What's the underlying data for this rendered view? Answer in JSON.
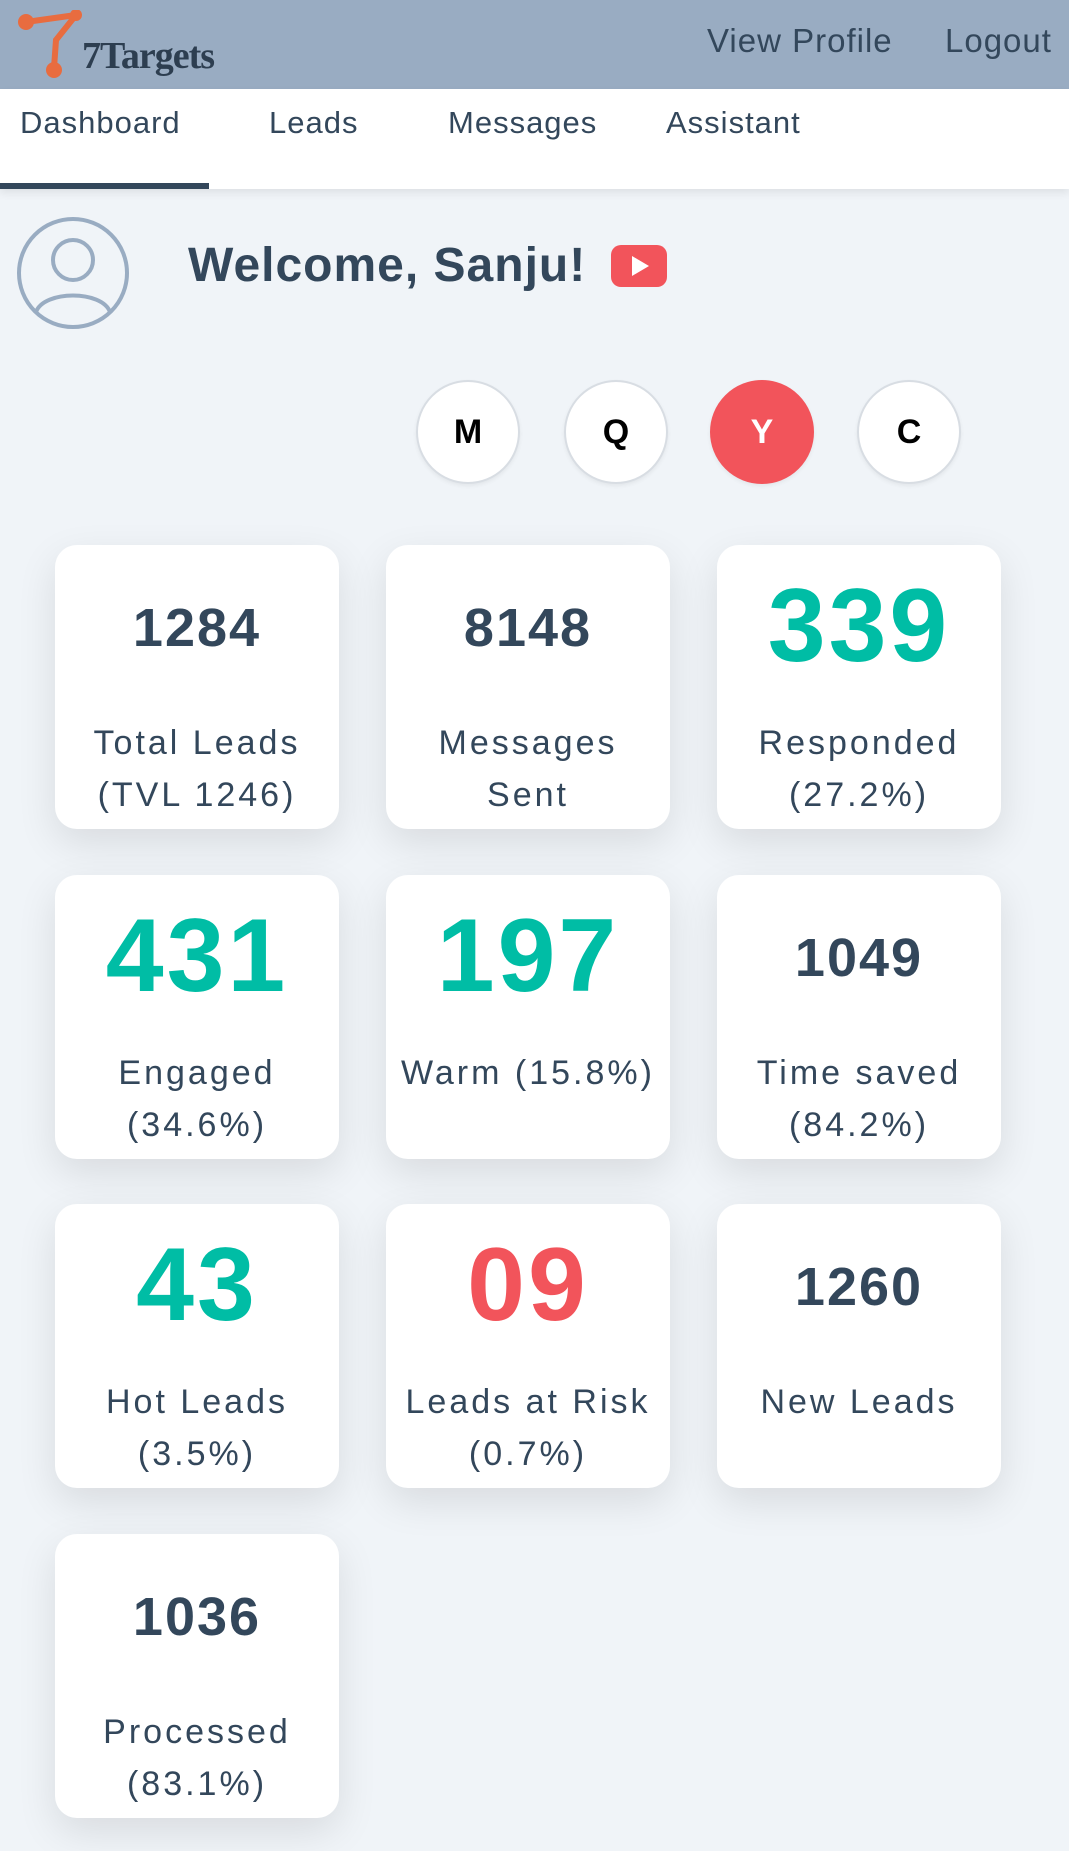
{
  "header": {
    "logo_text": "7Targets",
    "view_profile": "View Profile",
    "logout": "Logout"
  },
  "tabs": [
    {
      "label": "Dashboard",
      "active": true
    },
    {
      "label": "Leads"
    },
    {
      "label": "Messages"
    },
    {
      "label": "Assistant"
    }
  ],
  "welcome": {
    "text": "Welcome, Sanju!",
    "icon": "youtube-icon"
  },
  "periods": [
    {
      "label": "M"
    },
    {
      "label": "Q"
    },
    {
      "label": "Y",
      "active": true
    },
    {
      "label": "C"
    }
  ],
  "stats": [
    {
      "value": "1284",
      "label_line1": "Total Leads",
      "label_line2": "(TVL 1246)"
    },
    {
      "value": "8148",
      "label_line1": "Messages",
      "label_line2": "Sent"
    },
    {
      "value": "339",
      "label_line1": "Responded",
      "label_line2": "(27.2%)"
    },
    {
      "value": "431",
      "label_line1": "Engaged",
      "label_line2": "(34.6%)"
    },
    {
      "value": "197",
      "label_line1": "Warm (15.8%)",
      "label_line2": ""
    },
    {
      "value": "1049",
      "label_line1": "Time saved",
      "label_line2": "(84.2%)"
    },
    {
      "value": "43",
      "label_line1": "Hot Leads",
      "label_line2": "(3.5%)"
    },
    {
      "value": "09",
      "label_line1": "Leads at Risk",
      "label_line2": "(0.7%)"
    },
    {
      "value": "1260",
      "label_line1": "New Leads",
      "label_line2": ""
    },
    {
      "value": "1036",
      "label_line1": "Processed",
      "label_line2": "(83.1%)"
    }
  ],
  "colors": {
    "header_bg": "#99acc2",
    "accent_red": "#f2545b",
    "accent_green": "#00bda5",
    "text_dark": "#33475b",
    "page_bg": "#f0f4f8"
  }
}
